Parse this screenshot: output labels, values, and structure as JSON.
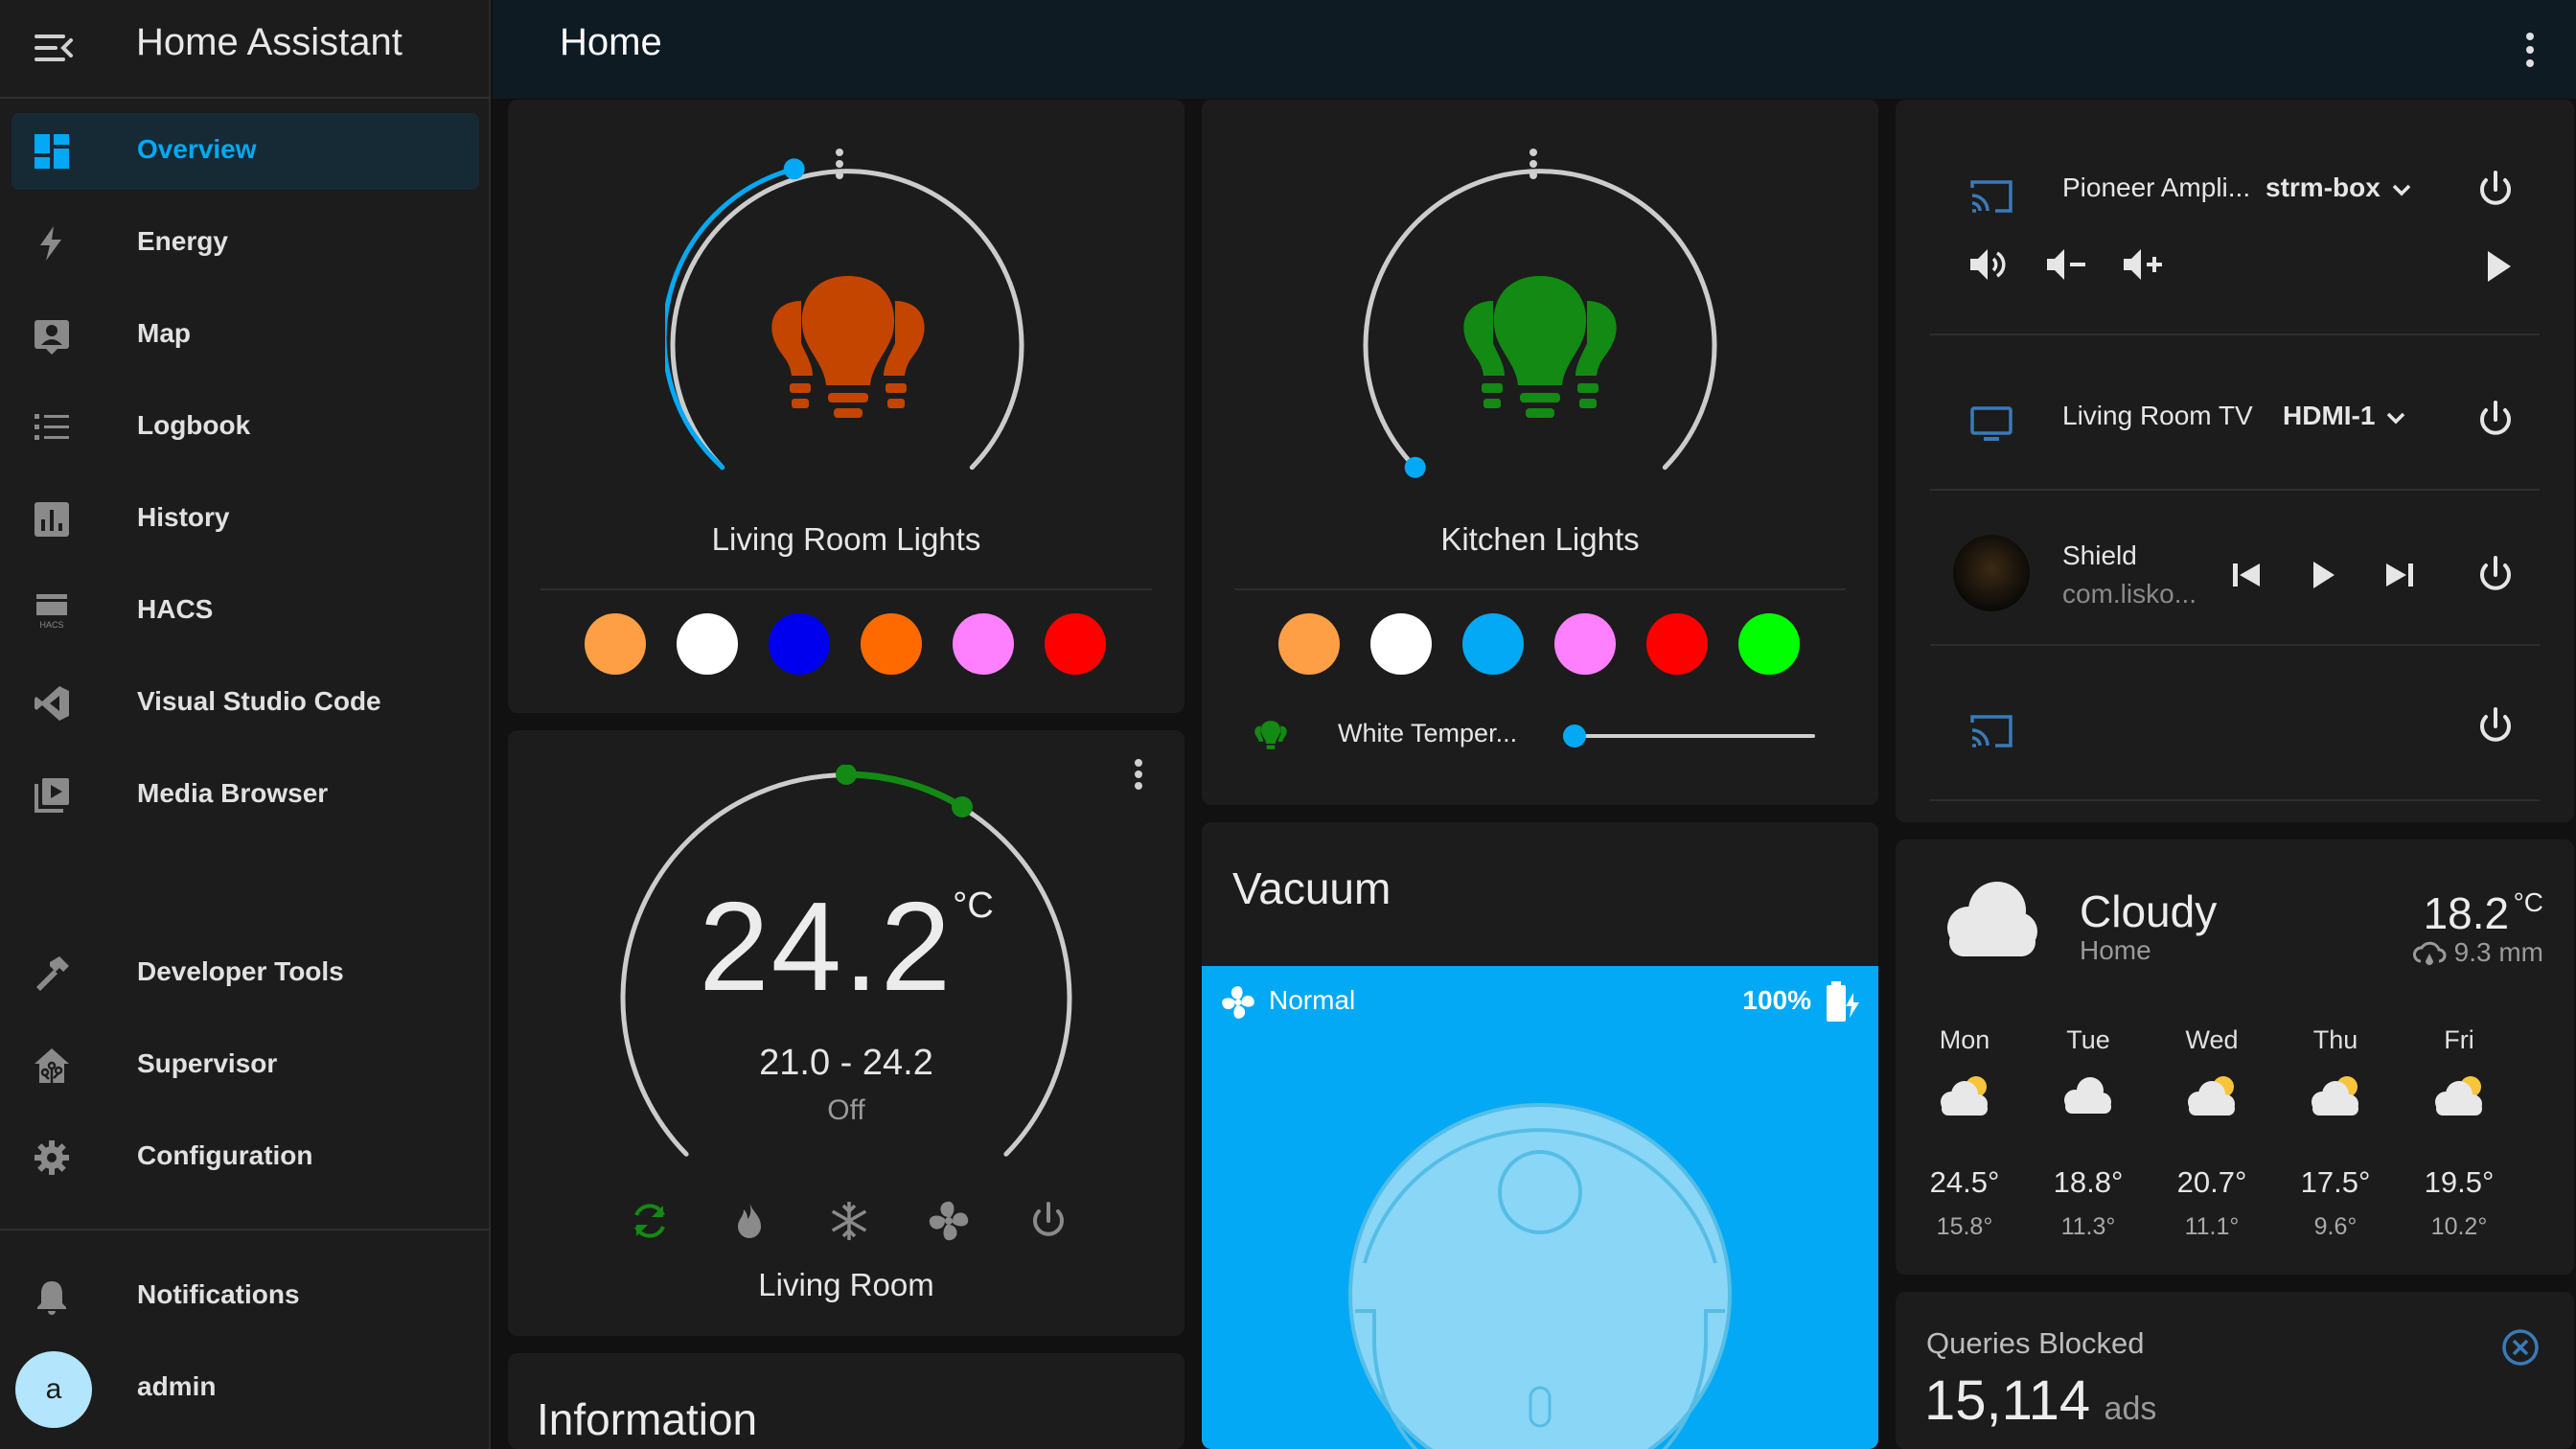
{
  "app": {
    "title": "Home Assistant"
  },
  "page": {
    "title": "Home"
  },
  "sidebar": {
    "items": [
      {
        "label": "Overview",
        "icon": "view-dashboard-icon",
        "active": true
      },
      {
        "label": "Energy",
        "icon": "lightning-bolt-icon"
      },
      {
        "label": "Map",
        "icon": "account-box-icon"
      },
      {
        "label": "Logbook",
        "icon": "format-list-bulleted-icon"
      },
      {
        "label": "History",
        "icon": "chart-box-icon"
      },
      {
        "label": "HACS",
        "icon": "hacs-icon"
      },
      {
        "label": "Visual Studio Code",
        "icon": "vscode-icon"
      },
      {
        "label": "Media Browser",
        "icon": "play-box-multiple-icon"
      },
      {
        "label": "Developer Tools",
        "icon": "hammer-icon"
      },
      {
        "label": "Supervisor",
        "icon": "home-assistant-icon"
      },
      {
        "label": "Configuration",
        "icon": "cog-icon"
      },
      {
        "label": "Notifications",
        "icon": "bell-icon"
      },
      {
        "label": "admin",
        "icon": "avatar"
      }
    ],
    "avatar_letter": "a"
  },
  "cards": {
    "living_room_lights": {
      "name": "Living Room Lights",
      "brightness_pct": 33,
      "icon_color": "#c44500",
      "colors": [
        "#ff9f45",
        "#ffffff",
        "#0000ee",
        "#ff6a00",
        "#ff80ff",
        "#ff0000"
      ]
    },
    "kitchen_lights": {
      "name": "Kitchen Lights",
      "brightness_pct": 0,
      "icon_color": "#138a13",
      "colors": [
        "#ff9f45",
        "#ffffff",
        "#03a9f4",
        "#ff80ff",
        "#ff0000",
        "#00ff00"
      ],
      "slider_label": "White Temper...",
      "slider_value_pct": 0
    },
    "thermostat": {
      "name": "Living Room",
      "current": "24.2",
      "unit": "°C",
      "range": "21.0 - 24.2",
      "state": "Off",
      "modes": [
        "heat-cool-icon",
        "fire-icon",
        "snowflake-icon",
        "fan-icon",
        "power-icon"
      ]
    },
    "information": {
      "title": "Information"
    },
    "vacuum": {
      "title": "Vacuum",
      "mode": "Normal",
      "battery": "100%",
      "bg_color": "#03a9f4"
    },
    "media": {
      "players": [
        {
          "name": "Pioneer Ampli...",
          "source": "strm-box"
        },
        {
          "name": "Living Room TV",
          "source": "HDMI-1"
        },
        {
          "name": "Shield",
          "subtitle": "com.lisko..."
        },
        {
          "name": ""
        }
      ]
    },
    "weather": {
      "condition": "Cloudy",
      "location": "Home",
      "temperature": "18.2",
      "unit": "°C",
      "precipitation": "9.3 mm",
      "forecast": [
        {
          "day": "Mon",
          "high": "24.5°",
          "low": "15.8°"
        },
        {
          "day": "Tue",
          "high": "18.8°",
          "low": "11.3°"
        },
        {
          "day": "Wed",
          "high": "20.7°",
          "low": "11.1°"
        },
        {
          "day": "Thu",
          "high": "17.5°",
          "low": "9.6°"
        },
        {
          "day": "Fri",
          "high": "19.5°",
          "low": "10.2°"
        }
      ]
    },
    "queries": {
      "label": "Queries Blocked",
      "value": "15,114",
      "unit": "ads"
    }
  }
}
